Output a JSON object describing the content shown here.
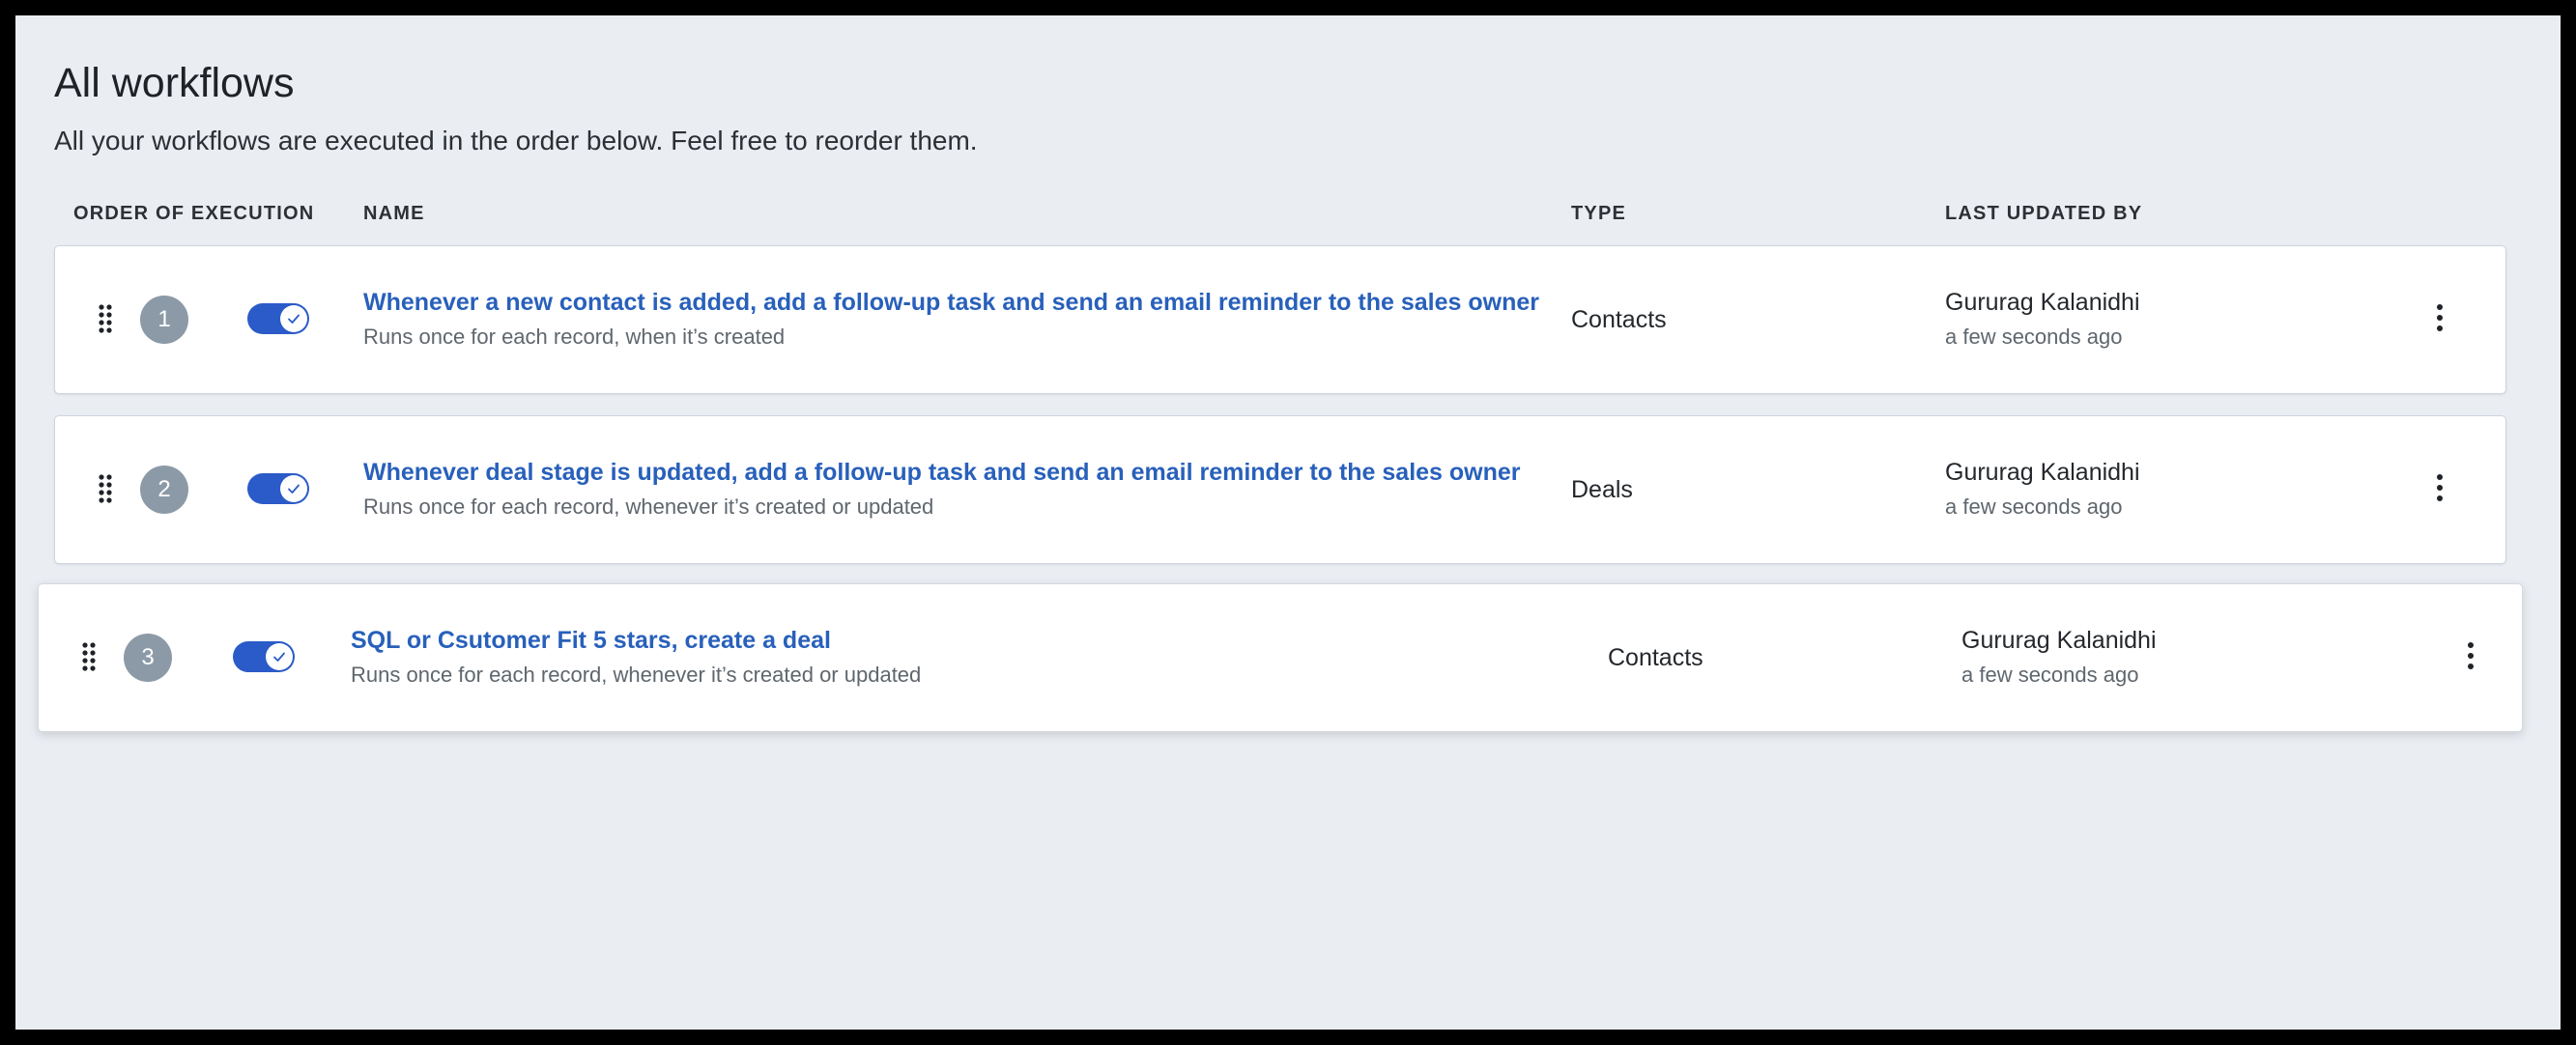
{
  "page": {
    "title": "All workflows",
    "subtitle": "All your workflows are executed in the order below. Feel free to reorder them."
  },
  "columns": {
    "order": "ORDER OF EXECUTION",
    "name": "NAME",
    "type": "TYPE",
    "updated": "LAST UPDATED BY"
  },
  "icons": {
    "drag": "drag-handle-icon",
    "check": "check-icon",
    "more": "kebab-menu-icon"
  },
  "colors": {
    "accent": "#2b5bc8",
    "link": "#2860bb",
    "badge": "#8c9aa7",
    "background": "#eaeef3"
  },
  "workflows": [
    {
      "order": "1",
      "enabled": true,
      "name": "Whenever a new contact is added, add a follow-up task and send an email reminder to the sales owner",
      "description": "Runs once for each record, when it’s created",
      "type": "Contacts",
      "updated_by": "Gururag Kalanidhi",
      "updated_at": "a few seconds ago"
    },
    {
      "order": "2",
      "enabled": true,
      "name": "Whenever deal stage is updated, add a follow-up task and send an email reminder to the sales owner",
      "description": "Runs once for each record, whenever it’s created or updated",
      "type": "Deals",
      "updated_by": "Gururag Kalanidhi",
      "updated_at": "a few seconds ago"
    },
    {
      "order": "3",
      "enabled": true,
      "name": "SQL or Csutomer Fit 5 stars, create a deal",
      "description": "Runs once for each record, whenever it’s created or updated",
      "type": "Contacts",
      "updated_by": "Gururag Kalanidhi",
      "updated_at": "a few seconds ago"
    }
  ]
}
